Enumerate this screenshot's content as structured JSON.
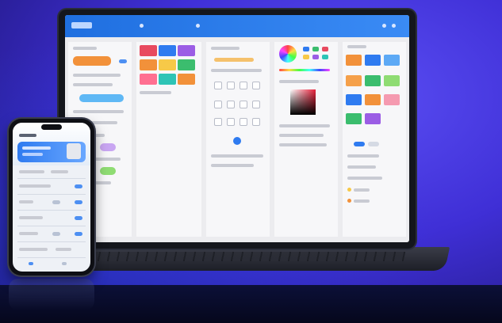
{
  "scene": {
    "description_free": true,
    "devices": [
      "laptop",
      "phone"
    ],
    "accent_color": "#2f7bf0",
    "background_color": "#3f2fd6"
  },
  "palette_tiles": [
    "#f2913a",
    "#e84a5f",
    "#3bbd6e",
    "#2f7bf0",
    "#9b5de5",
    "#f7c948",
    "#2ec4b6",
    "#ff6f91"
  ]
}
